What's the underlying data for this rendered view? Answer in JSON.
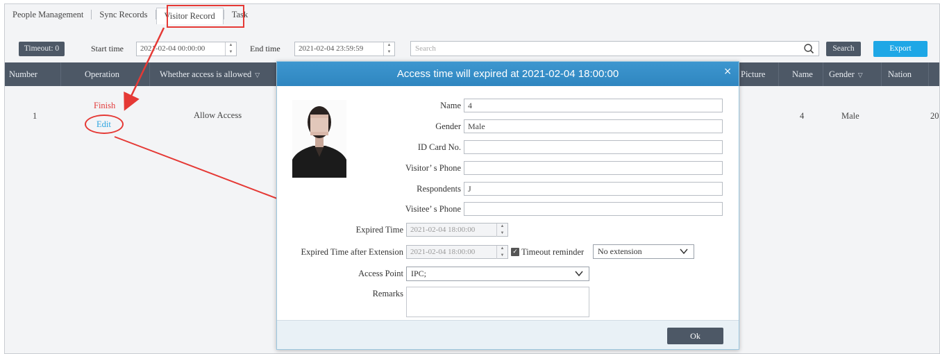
{
  "tabs": [
    "People Management",
    "Sync Records",
    "Visitor Record",
    "Task"
  ],
  "toolbar": {
    "timeout_label": "Timeout: 0",
    "start_time_label": "Start time",
    "start_time_value": "2021-02-04 00:00:00",
    "end_time_label": "End time",
    "end_time_value": "2021-02-04 23:59:59",
    "search_placeholder": "Search",
    "search_button": "Search",
    "export_button": "Export"
  },
  "table": {
    "columns": [
      "Number",
      "Operation",
      "Whether access is allowed",
      "Picture",
      "Name",
      "Gender",
      "Nation"
    ],
    "row": {
      "number": "1",
      "finish": "Finish",
      "edit": "Edit",
      "access": "Allow Access",
      "name": "4",
      "gender": "Male",
      "date_fragment": "20"
    }
  },
  "modal": {
    "title": "Access time will expired at 2021-02-04 18:00:00",
    "close": "×",
    "fields": {
      "name_label": "Name",
      "name_value": "4",
      "gender_label": "Gender",
      "gender_value": "Male",
      "id_label": "ID Card No.",
      "id_value": "",
      "visitor_phone_label": "Visitor’ s Phone",
      "visitor_phone_value": "",
      "respondents_label": "Respondents",
      "respondents_value": "J",
      "visitee_phone_label": "Visitee’ s Phone",
      "visitee_phone_value": "",
      "expired_label": "Expired Time",
      "expired_value": "2021-02-04 18:00:00",
      "expired_ext_label": "Expired Time after Extension",
      "expired_ext_value": "2021-02-04 18:00:00",
      "timeout_reminder": "Timeout reminder",
      "extension_select": "No extension",
      "access_point_label": "Access Point",
      "access_point_value": "IPC;",
      "remarks_label": "Remarks"
    },
    "ok": "Ok"
  },
  "colors": {
    "accent_blue": "#1ea7e6",
    "dark_gray": "#4d5866",
    "annotation_red": "#e53935",
    "modal_header": "#3a93cc"
  }
}
